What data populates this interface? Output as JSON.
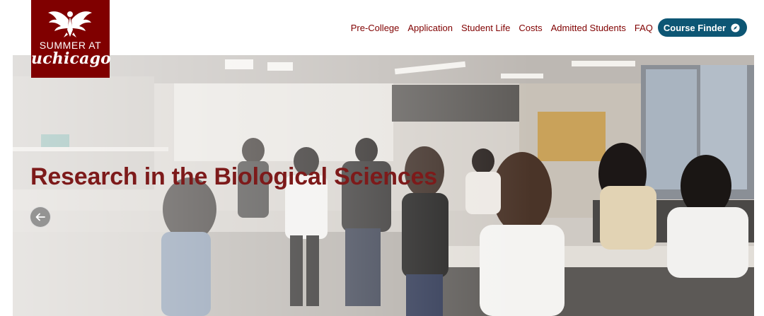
{
  "logo": {
    "line1": "SUMMER AT",
    "line2": "uchicago",
    "icon": "phoenix-icon"
  },
  "nav": {
    "items": [
      {
        "label": "Pre-College"
      },
      {
        "label": "Application"
      },
      {
        "label": "Student Life"
      },
      {
        "label": "Costs"
      },
      {
        "label": "Admitted Students"
      },
      {
        "label": "FAQ"
      }
    ],
    "course_finder": {
      "label": "Course Finder",
      "icon": "compass-icon"
    }
  },
  "hero": {
    "title": "Research in the Biological Sciences",
    "prev_icon": "arrow-left-icon"
  },
  "colors": {
    "maroon": "#800000",
    "title": "#7d1a1a",
    "finder_bg": "#0d5674"
  }
}
